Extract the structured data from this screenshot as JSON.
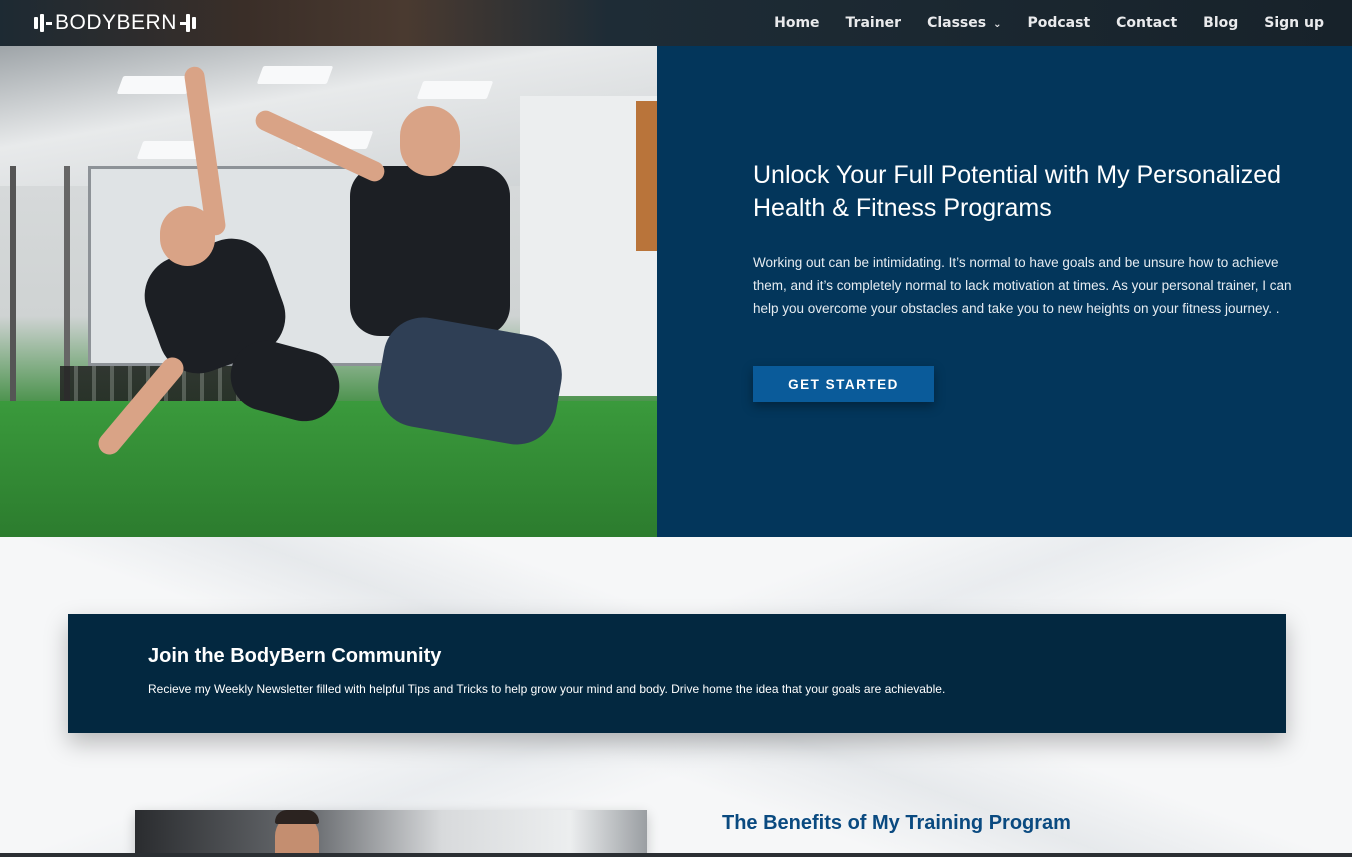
{
  "brand": {
    "logo_text": "BODYBERN"
  },
  "nav": {
    "items": [
      {
        "label": "Home"
      },
      {
        "label": "Trainer"
      },
      {
        "label": "Classes",
        "has_dropdown": true,
        "icon": "chevron-down-icon"
      },
      {
        "label": "Podcast"
      },
      {
        "label": "Contact"
      },
      {
        "label": "Blog"
      },
      {
        "label": "Sign up"
      }
    ],
    "chevron": "⌄"
  },
  "hero": {
    "title": "Unlock Your Full Potential with My Personalized Health & Fitness Programs",
    "text": "Working out can be intimidating. It’s normal to have goals and be unsure how to achieve them, and it’s completely normal to lack motivation at times. As your personal trainer, I can help you overcome your obstacles and take you to new heights on your fitness journey. .",
    "cta_label": "GET STARTED",
    "panel_color": "#03365b",
    "cta_color": "#0a5b9a"
  },
  "newsletter": {
    "title": "Join the BodyBern Community",
    "text": "Recieve my Weekly Newsletter filled with helpful Tips and Tricks to help grow your mind and body. Drive home the idea that your goals are achievable.",
    "bg_color": "#032840"
  },
  "benefits": {
    "title": "The Benefits of My Training Program",
    "title_color": "#0a4a80"
  }
}
